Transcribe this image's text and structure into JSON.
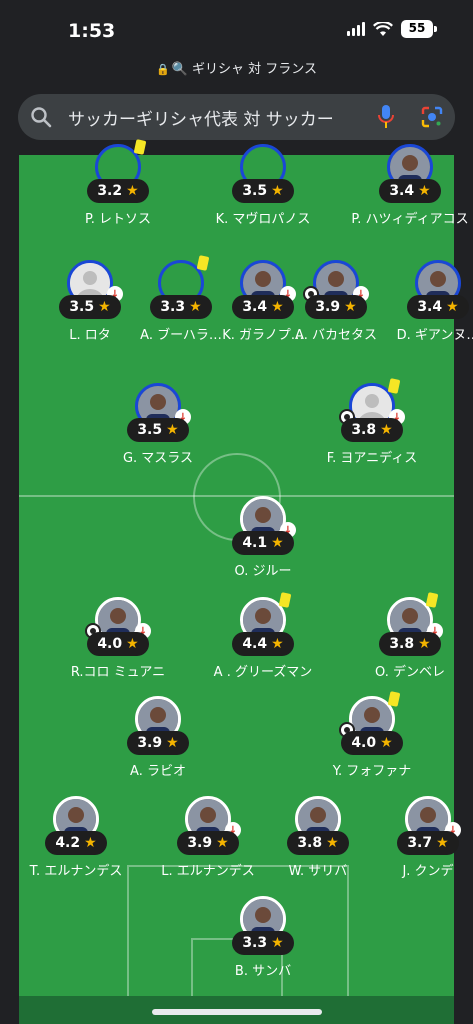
{
  "status": {
    "time": "1:53",
    "battery": "55"
  },
  "url": {
    "text": "ギリシャ 対 フランス"
  },
  "search": {
    "query": "サッカーギリシャ代表 対 サッカー"
  },
  "colors": {
    "pitch": "#2e9d45",
    "greece_ring": "#1a47d6",
    "france_ring": "#ffffff",
    "star": "#f4b400",
    "yellow_card": "#f5e625",
    "sub_arrow": "#d93025"
  },
  "players": [
    {
      "id": "p1",
      "name": "P. レトソス",
      "rating": "3.2",
      "icon": "blank",
      "card": true,
      "sub": false,
      "goal": false
    },
    {
      "id": "p2",
      "name": "K. マヴロパノス",
      "rating": "3.5",
      "icon": "blank",
      "card": false,
      "sub": false,
      "goal": false
    },
    {
      "id": "p3",
      "name": "P. ハツィディアコス",
      "rating": "3.4",
      "icon": "photo",
      "card": false,
      "sub": false,
      "goal": false
    },
    {
      "id": "p4",
      "name": "L. ロタ",
      "rating": "3.5",
      "icon": "silhouette",
      "card": false,
      "sub": true,
      "goal": false
    },
    {
      "id": "p5",
      "name": "A. ブーハラ…",
      "rating": "3.3",
      "icon": "blank",
      "card": true,
      "sub": false,
      "goal": false
    },
    {
      "id": "p6",
      "name": "K. ガラノプ…",
      "rating": "3.4",
      "icon": "photo",
      "card": false,
      "sub": true,
      "goal": false
    },
    {
      "id": "p7",
      "name": "A. バカセタス",
      "rating": "3.9",
      "icon": "photo",
      "card": false,
      "sub": true,
      "goal": true
    },
    {
      "id": "p8",
      "name": "D. ギアンヌ…",
      "rating": "3.4",
      "icon": "photo",
      "card": false,
      "sub": false,
      "goal": false
    },
    {
      "id": "p9",
      "name": "G. マスラス",
      "rating": "3.5",
      "icon": "photo",
      "card": false,
      "sub": true,
      "goal": false
    },
    {
      "id": "p10",
      "name": "F. ヨアニディス",
      "rating": "3.8",
      "icon": "silhouette",
      "card": true,
      "sub": true,
      "goal": true
    },
    {
      "id": "p11",
      "name": "O. ジルー",
      "rating": "4.1",
      "icon": "photo",
      "card": false,
      "sub": true,
      "goal": false
    },
    {
      "id": "p12",
      "name": "R.コロ ミュアニ",
      "rating": "4.0",
      "icon": "photo",
      "card": false,
      "sub": true,
      "goal": true
    },
    {
      "id": "p13",
      "name": "A . グリーズマン",
      "rating": "4.4",
      "icon": "photo",
      "card": true,
      "sub": false,
      "goal": false
    },
    {
      "id": "p14",
      "name": "O. デンベレ",
      "rating": "3.8",
      "icon": "photo",
      "card": true,
      "sub": true,
      "goal": false
    },
    {
      "id": "p15",
      "name": "A. ラビオ",
      "rating": "3.9",
      "icon": "photo",
      "card": false,
      "sub": false,
      "goal": false
    },
    {
      "id": "p16",
      "name": "Y. フォファナ",
      "rating": "4.0",
      "icon": "photo",
      "card": true,
      "sub": false,
      "goal": true
    },
    {
      "id": "p17",
      "name": "T. エルナンデス",
      "rating": "4.2",
      "icon": "photo",
      "card": false,
      "sub": false,
      "goal": false
    },
    {
      "id": "p18",
      "name": "L. エルナンデス",
      "rating": "3.9",
      "icon": "photo",
      "card": false,
      "sub": true,
      "goal": false
    },
    {
      "id": "p19",
      "name": "W. サリバ",
      "rating": "3.8",
      "icon": "photo",
      "card": false,
      "sub": false,
      "goal": false
    },
    {
      "id": "p20",
      "name": "J. クンデ",
      "rating": "3.7",
      "icon": "photo",
      "card": false,
      "sub": true,
      "goal": false
    },
    {
      "id": "p21",
      "name": "B. サンバ",
      "rating": "3.3",
      "icon": "photo",
      "card": false,
      "sub": false,
      "goal": false
    }
  ]
}
